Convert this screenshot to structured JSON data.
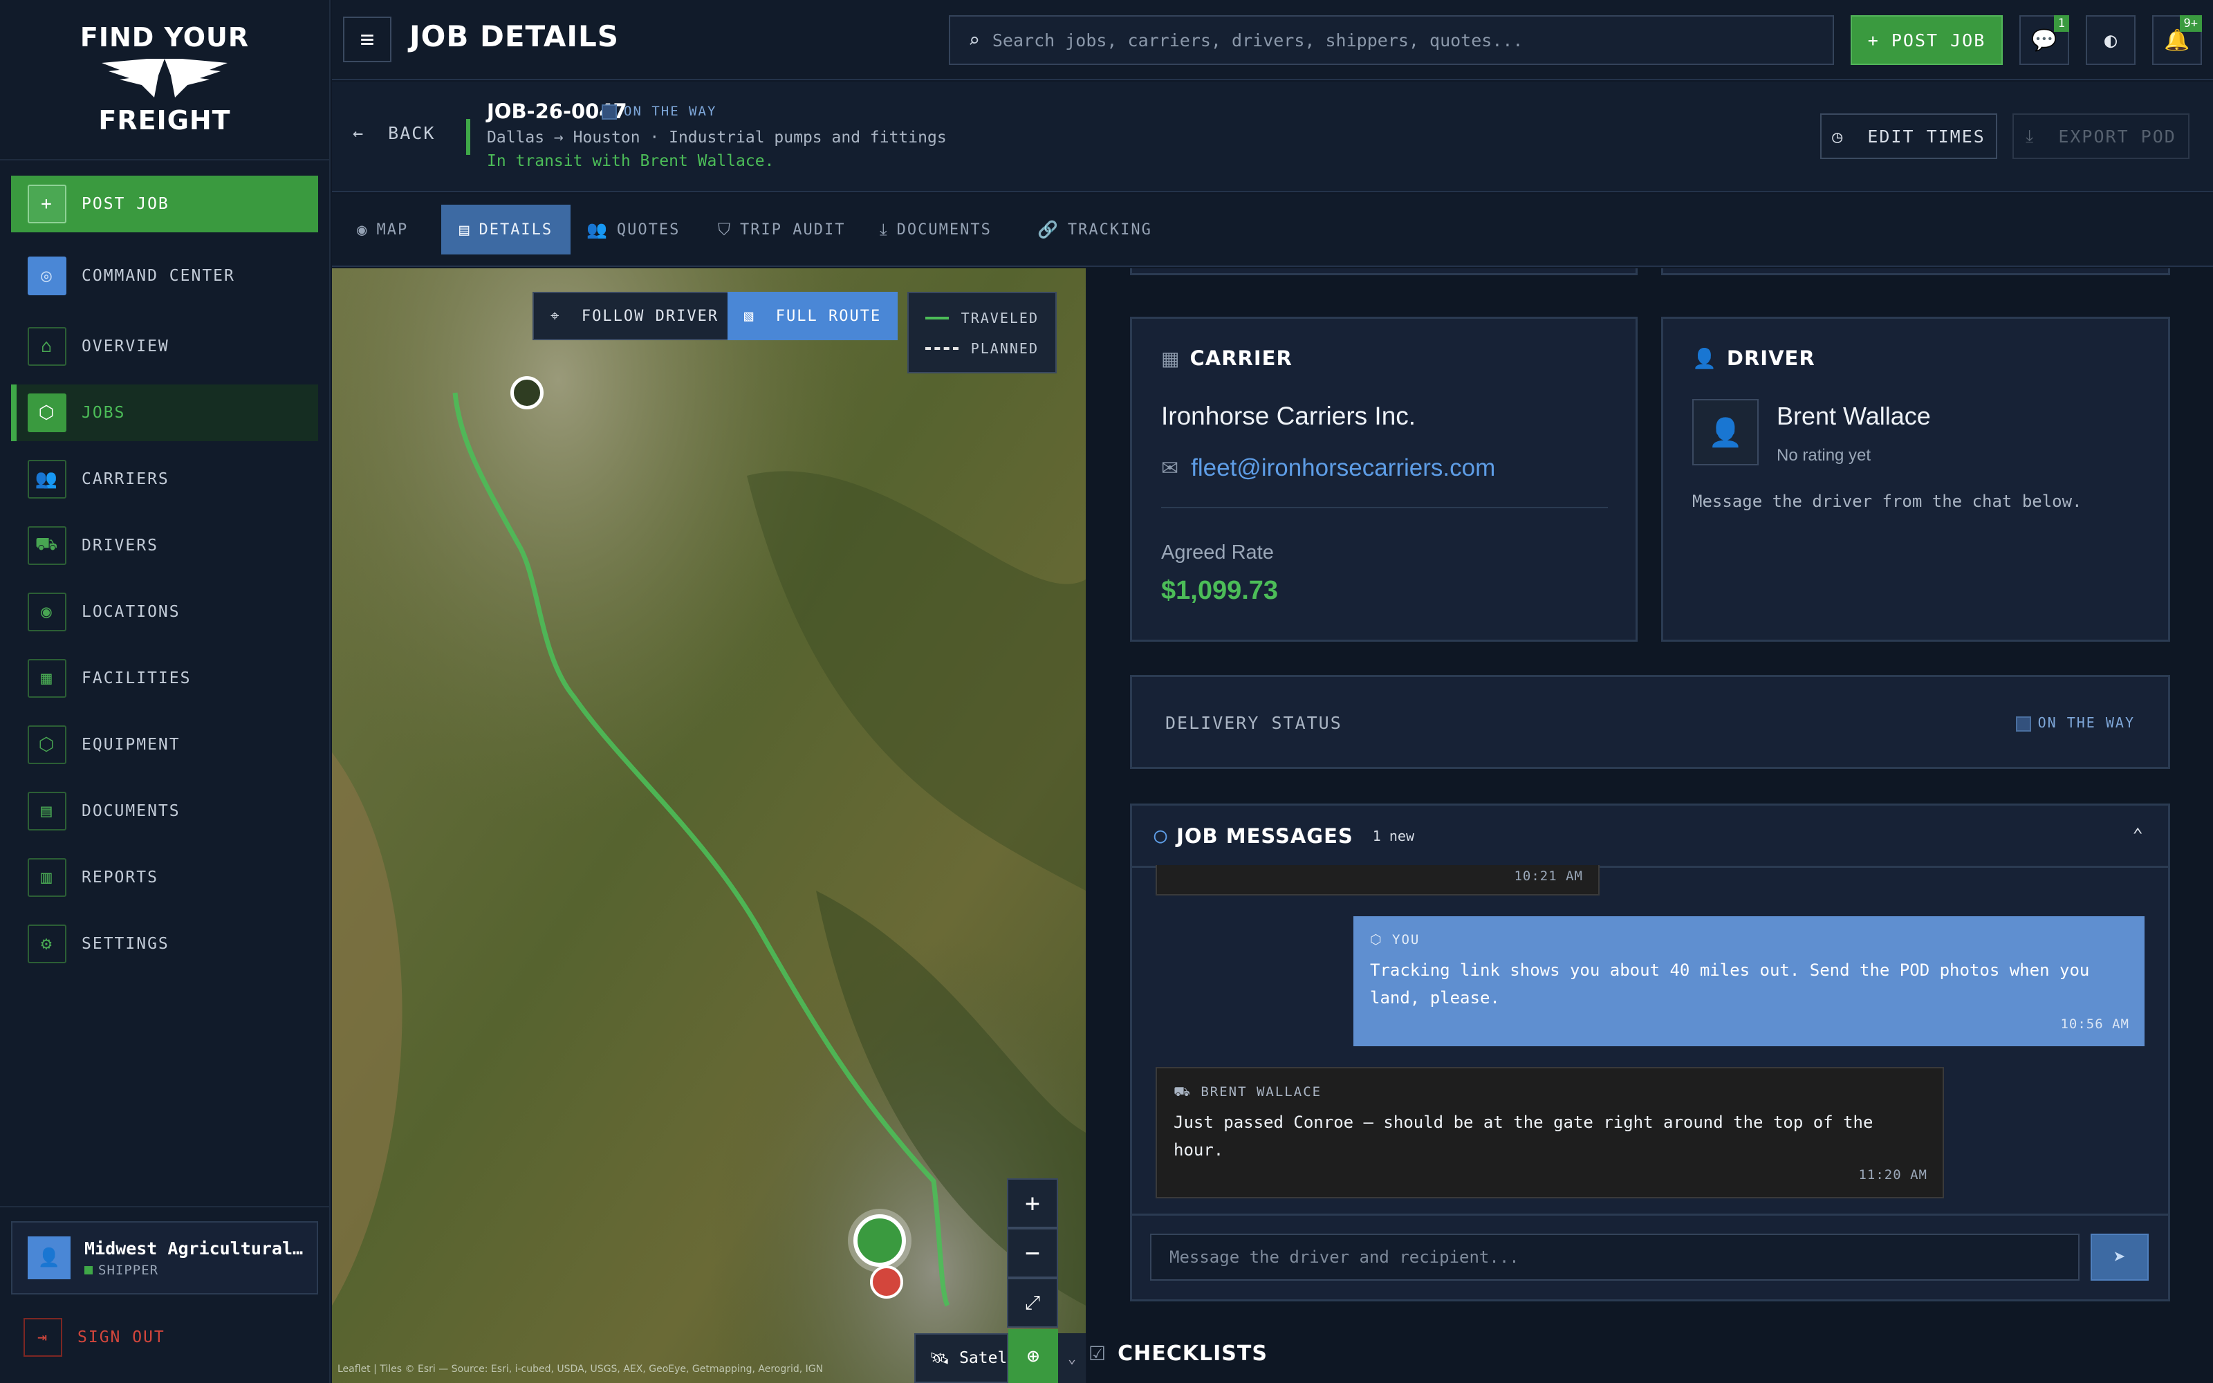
{
  "brand": {
    "logo_line1": "FIND YOUR",
    "logo_line2": "FREIGHT"
  },
  "sidebar": {
    "items": [
      {
        "label": "POST JOB",
        "icon": "plus-icon"
      },
      {
        "label": "COMMAND CENTER",
        "icon": "radar-icon"
      },
      {
        "label": "OVERVIEW",
        "icon": "home-icon"
      },
      {
        "label": "JOBS",
        "icon": "package-icon"
      },
      {
        "label": "CARRIERS",
        "icon": "users-icon"
      },
      {
        "label": "DRIVERS",
        "icon": "truck-icon"
      },
      {
        "label": "LOCATIONS",
        "icon": "map-pin-icon"
      },
      {
        "label": "FACILITIES",
        "icon": "building-icon"
      },
      {
        "label": "EQUIPMENT",
        "icon": "box-icon"
      },
      {
        "label": "DOCUMENTS",
        "icon": "document-icon"
      },
      {
        "label": "REPORTS",
        "icon": "bar-chart-icon"
      },
      {
        "label": "SETTINGS",
        "icon": "gear-icon"
      }
    ],
    "active": "JOBS",
    "user": {
      "name": "Midwest Agricultural…",
      "role": "SHIPPER"
    },
    "sign_out": "SIGN OUT"
  },
  "topbar": {
    "title": "JOB DETAILS",
    "search_placeholder": "Search jobs, carriers, drivers, shippers, quotes...",
    "post_job": "+ POST JOB",
    "chat_badge": "1",
    "notif_badge": "9+"
  },
  "job": {
    "back": "BACK",
    "id": "JOB-26-0047",
    "status": "ON THE WAY",
    "route": "Dallas → Houston · Industrial pumps and fittings",
    "transit": "In transit with Brent Wallace.",
    "edit_times": "EDIT TIMES",
    "export_pod": "EXPORT POD"
  },
  "tabs": [
    {
      "label": "MAP",
      "icon": "map-pin-icon"
    },
    {
      "label": "DETAILS",
      "icon": "document-icon"
    },
    {
      "label": "QUOTES",
      "icon": "users-icon"
    },
    {
      "label": "TRIP AUDIT",
      "icon": "shield-icon"
    },
    {
      "label": "DOCUMENTS",
      "icon": "download-icon"
    },
    {
      "label": "TRACKING",
      "icon": "link-icon"
    }
  ],
  "active_tab": "DETAILS",
  "map": {
    "follow_driver": "FOLLOW DRIVER",
    "full_route": "FULL ROUTE",
    "legend_traveled": "TRAVELED",
    "legend_planned": "PLANNED",
    "zoom_in": "+",
    "zoom_out": "−",
    "layer": "Satellite",
    "attribution": "Leaflet | Tiles © Esri — Source: Esri, i-cubed, USDA, USGS, AEX, GeoEye, Getmapping, Aerogrid, IGN"
  },
  "carrier": {
    "title": "CARRIER",
    "name": "Ironhorse Carriers Inc.",
    "email": "fleet@ironhorsecarriers.com",
    "rate_label": "Agreed Rate",
    "rate": "$1,099.73"
  },
  "driver": {
    "title": "DRIVER",
    "name": "Brent Wallace",
    "rating": "No rating yet",
    "note": "Message the driver from the chat below."
  },
  "delivery": {
    "label": "DELIVERY STATUS",
    "status": "ON THE WAY"
  },
  "messages": {
    "title": "JOB MESSAGES",
    "new_count": "1 new",
    "items": [
      {
        "time": "10:21 AM"
      },
      {
        "who": "YOU",
        "text": "Tracking link shows you about 40 miles out. Send the POD photos when you land, please.",
        "time": "10:56 AM"
      },
      {
        "who": "BRENT WALLACE",
        "text": "Just passed Conroe — should be at the gate right around the top of the hour.",
        "time": "11:20 AM"
      }
    ],
    "input_placeholder": "Message the driver and recipient..."
  },
  "checklists": {
    "title": "CHECKLISTS"
  },
  "colors": {
    "accent_green": "#3a9a3f",
    "accent_blue": "#4a87d6",
    "danger": "#d3463c"
  }
}
